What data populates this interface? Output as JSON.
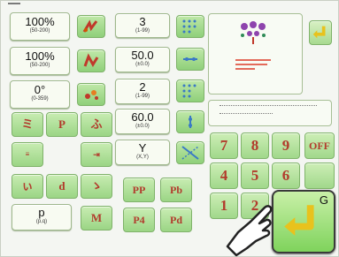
{
  "settings": [
    {
      "value": "100%",
      "range": "(50-200)"
    },
    {
      "value": "100%",
      "range": "(50-200)"
    },
    {
      "value": "0°",
      "range": "(0-359)"
    }
  ],
  "counts": [
    {
      "value": "3",
      "range": "(1-99)"
    },
    {
      "value": "50.0",
      "range": "(±0.0)"
    },
    {
      "value": "2",
      "range": "(1-99)"
    },
    {
      "value": "60.0",
      "range": "(±0.0)"
    },
    {
      "value": "Y",
      "range": "(X,Y)"
    }
  ],
  "pattern_point": {
    "value": "p",
    "range": "(p,q)"
  },
  "tool_buttons": [
    "P",
    "M"
  ],
  "step_buttons": [
    "PP",
    "Pb",
    "P4",
    "Pd"
  ],
  "keypad": [
    "7",
    "8",
    "9",
    "4",
    "5",
    "6",
    "1",
    "2"
  ],
  "side_keys": {
    "off": "OFF"
  },
  "callout_label": "G",
  "colors": {
    "accent_green": "#8fd07a",
    "accent_yellow": "#e8c21d",
    "text_red": "#b23b2c"
  },
  "icons": [
    "pattern-preview-icon",
    "return-arrow-icon",
    "hand-pointer-icon"
  ]
}
